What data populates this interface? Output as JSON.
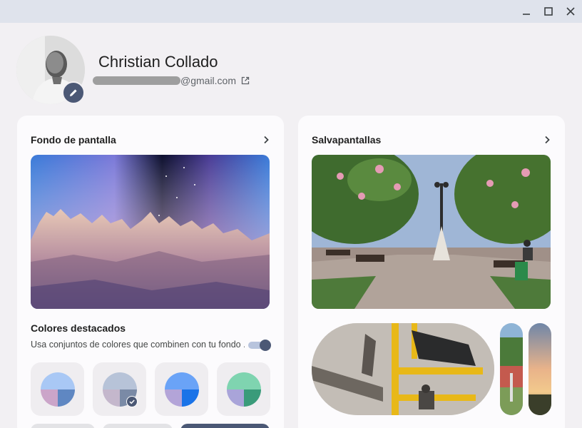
{
  "window": {
    "controls": [
      "minimize-icon",
      "maximize-icon",
      "close-icon"
    ]
  },
  "profile": {
    "name": "Christian Collado",
    "email_domain": "@gmail.com",
    "avatar_icon": "pencil-icon",
    "external_icon": "open-in-new-icon"
  },
  "wallpaper_card": {
    "title": "Fondo de pantalla",
    "chevron_icon": "chevron-right-icon",
    "colors": {
      "title": "Colores destacados",
      "description": "Usa conjuntos de colores que combinen con tu fondo ...",
      "toggle_on": true,
      "accent": "#4b5875",
      "swatches": [
        {
          "top_left": "#a9c8f5",
          "bottom_left": "#cba5c9",
          "bottom_right": "#5f87c2",
          "selected": false
        },
        {
          "top_left": "#b7c3d8",
          "bottom_left": "#c4b7cc",
          "bottom_right": "#7a8aa6",
          "selected": true
        },
        {
          "top_left": "#6aa3f7",
          "bottom_left": "#b3a4d8",
          "bottom_right": "#1a73e8",
          "selected": false
        },
        {
          "top_left": "#7fd4b0",
          "bottom_left": "#a9a4d9",
          "bottom_right": "#3a9b7a",
          "selected": false
        }
      ]
    }
  },
  "screensaver_card": {
    "title": "Salvapantallas",
    "chevron_icon": "chevron-right-icon"
  }
}
